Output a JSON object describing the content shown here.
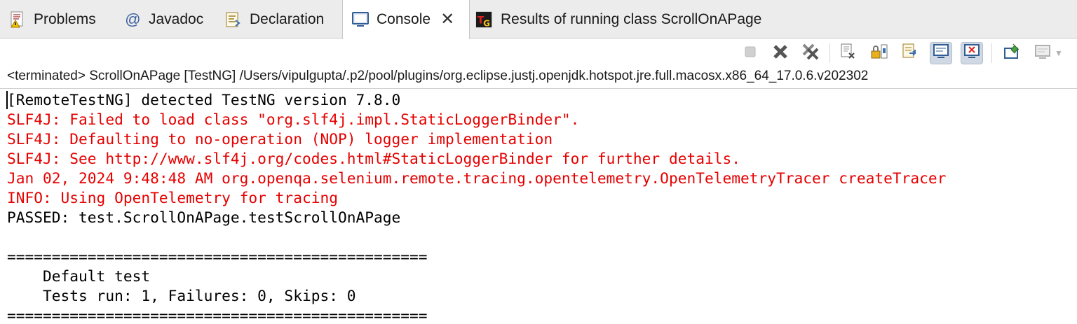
{
  "tabs": [
    {
      "label": "Problems",
      "icon": "problems-icon",
      "active": false
    },
    {
      "label": "Javadoc",
      "icon": "at-icon",
      "active": false
    },
    {
      "label": "Declaration",
      "icon": "declaration-icon",
      "active": false
    },
    {
      "label": "Console",
      "icon": "console-icon",
      "active": true
    },
    {
      "label": "Results of running class ScrollOnAPage",
      "icon": "testng-icon",
      "active": false
    }
  ],
  "toolbar": {
    "buttons": [
      "terminate-icon",
      "remove-launch-icon",
      "remove-all-launches-icon",
      "clear-console-icon",
      "scroll-lock-icon",
      "word-wrap-icon",
      "show-on-stdout-icon",
      "show-on-stderr-icon",
      "pin-console-icon",
      "display-console-icon"
    ]
  },
  "path_text": "<terminated> ScrollOnAPage [TestNG] /Users/vipulgupta/.p2/pool/plugins/org.eclipse.justj.openjdk.hotspot.jre.full.macosx.x86_64_17.0.6.v202302",
  "console": {
    "lines": [
      {
        "text": "[RemoteTestNG] detected TestNG version 7.8.0",
        "color": "black"
      },
      {
        "text": "SLF4J: Failed to load class \"org.slf4j.impl.StaticLoggerBinder\".",
        "color": "red"
      },
      {
        "text": "SLF4J: Defaulting to no-operation (NOP) logger implementation",
        "color": "red"
      },
      {
        "text": "SLF4J: See http://www.slf4j.org/codes.html#StaticLoggerBinder for further details.",
        "color": "red"
      },
      {
        "text": "Jan 02, 2024 9:48:48 AM org.openqa.selenium.remote.tracing.opentelemetry.OpenTelemetryTracer createTracer",
        "color": "red"
      },
      {
        "text": "INFO: Using OpenTelemetry for tracing",
        "color": "red"
      },
      {
        "text": "PASSED: test.ScrollOnAPage.testScrollOnAPage",
        "color": "black"
      },
      {
        "text": "",
        "color": "black"
      },
      {
        "text": "===============================================",
        "color": "black"
      },
      {
        "text": "    Default test",
        "color": "black"
      },
      {
        "text": "    Tests run: 1, Failures: 0, Skips: 0",
        "color": "black"
      },
      {
        "text": "===============================================",
        "color": "black"
      }
    ]
  },
  "colors": {
    "error_red": "#e60000",
    "text_black": "#000000",
    "tab_bar": "#ececec"
  }
}
